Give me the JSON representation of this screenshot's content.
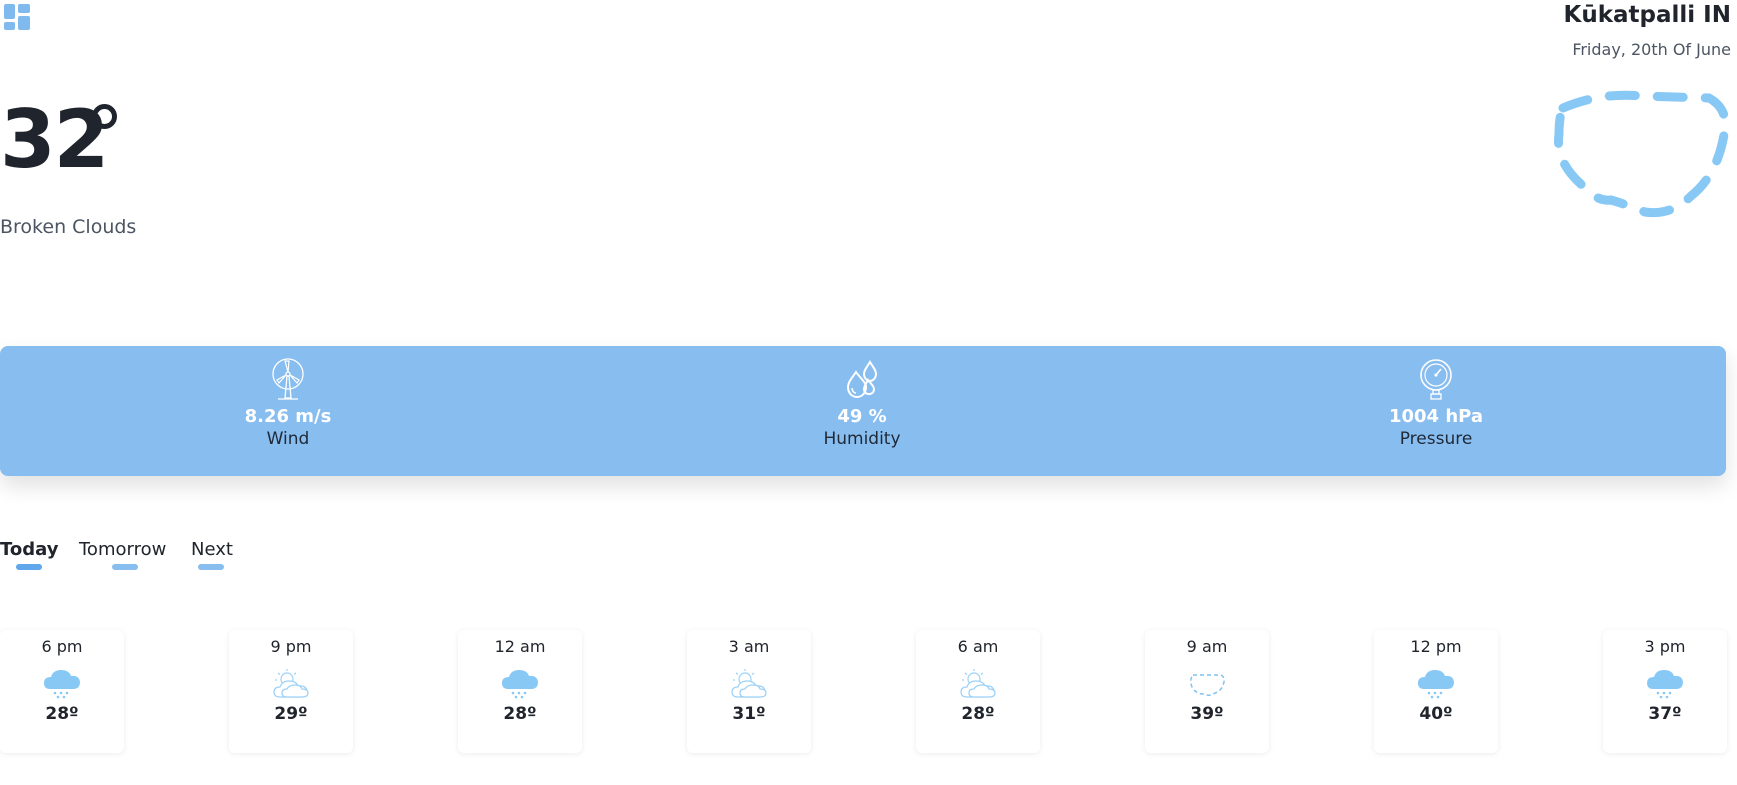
{
  "header": {
    "menu_icon": "dashboard-grid-icon"
  },
  "location": {
    "city": "Kūkatpalli IN",
    "date": "Friday, 20th Of June"
  },
  "current": {
    "temperature": "32",
    "description": "Broken Clouds",
    "icon": "dashed-cloud-icon",
    "accent_color": "#88bdf0"
  },
  "stats": [
    {
      "value": "8.26 m/s",
      "label": "Wind",
      "icon": "wind-turbine-icon"
    },
    {
      "value": "49 %",
      "label": "Humidity",
      "icon": "water-drops-icon"
    },
    {
      "value": "1004 hPa",
      "label": "Pressure",
      "icon": "pressure-gauge-icon"
    }
  ],
  "tabs": [
    {
      "label": "Today",
      "active": true
    },
    {
      "label": "Tomorrow",
      "active": false
    },
    {
      "label": "Next",
      "active": false
    }
  ],
  "forecast": [
    {
      "time": "6 pm",
      "temp": "28º",
      "icon": "snow-cloud-icon"
    },
    {
      "time": "9 pm",
      "temp": "29º",
      "icon": "sun-behind-clouds-icon"
    },
    {
      "time": "12 am",
      "temp": "28º",
      "icon": "snow-cloud-icon"
    },
    {
      "time": "3 am",
      "temp": "31º",
      "icon": "sun-behind-clouds-icon"
    },
    {
      "time": "6 am",
      "temp": "28º",
      "icon": "sun-behind-clouds-icon"
    },
    {
      "time": "9 am",
      "temp": "39º",
      "icon": "dashed-cloud-icon"
    },
    {
      "time": "12 pm",
      "temp": "40º",
      "icon": "snow-cloud-icon"
    },
    {
      "time": "3 pm",
      "temp": "37º",
      "icon": "snow-cloud-icon"
    }
  ]
}
